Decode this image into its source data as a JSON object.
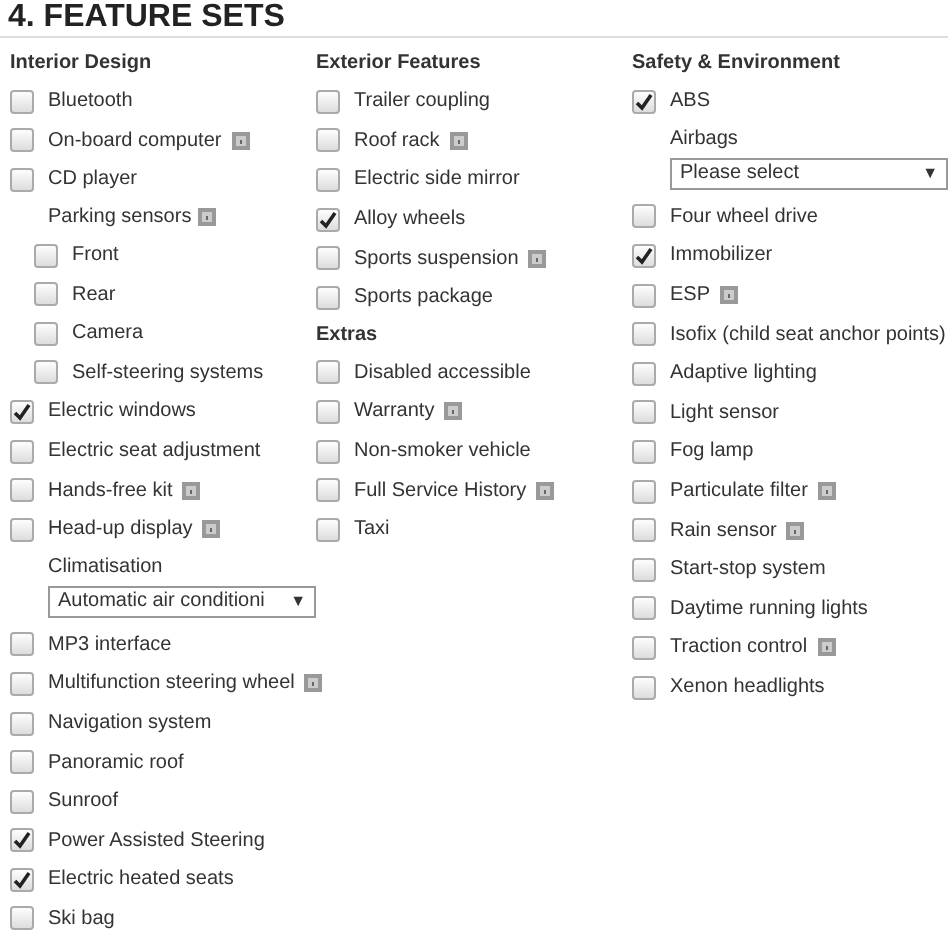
{
  "title": "4. FEATURE SETS",
  "columns": [
    {
      "sections": [
        {
          "heading": "Interior Design",
          "items": [
            {
              "kind": "checkbox",
              "label": "Bluetooth",
              "checked": false,
              "help": false
            },
            {
              "kind": "checkbox",
              "label": "On-board computer",
              "checked": false,
              "help": true
            },
            {
              "kind": "checkbox",
              "label": "CD player",
              "checked": false,
              "help": false
            },
            {
              "kind": "label",
              "label": "Parking sensors",
              "help": true,
              "children": [
                {
                  "kind": "checkbox",
                  "label": "Front",
                  "checked": false,
                  "help": false
                },
                {
                  "kind": "checkbox",
                  "label": "Rear",
                  "checked": false,
                  "help": false
                },
                {
                  "kind": "checkbox",
                  "label": "Camera",
                  "checked": false,
                  "help": false
                },
                {
                  "kind": "checkbox",
                  "label": "Self-steering systems",
                  "checked": false,
                  "help": false
                }
              ]
            },
            {
              "kind": "checkbox",
              "label": "Electric windows",
              "checked": true,
              "help": false
            },
            {
              "kind": "checkbox",
              "label": "Electric seat adjustment",
              "checked": false,
              "help": false
            },
            {
              "kind": "checkbox",
              "label": "Hands-free kit",
              "checked": false,
              "help": true
            },
            {
              "kind": "checkbox",
              "label": "Head-up display",
              "checked": false,
              "help": true
            },
            {
              "kind": "select",
              "label": "Climatisation",
              "value": "Automatic air conditioni",
              "arrow": "▼"
            },
            {
              "kind": "checkbox",
              "label": "MP3 interface",
              "checked": false,
              "help": false
            },
            {
              "kind": "checkbox",
              "label": "Multifunction steering wheel",
              "checked": false,
              "help": true
            },
            {
              "kind": "checkbox",
              "label": "Navigation system",
              "checked": false,
              "help": false
            },
            {
              "kind": "checkbox",
              "label": "Panoramic roof",
              "checked": false,
              "help": false
            },
            {
              "kind": "checkbox",
              "label": "Sunroof",
              "checked": false,
              "help": false
            },
            {
              "kind": "checkbox",
              "label": "Power Assisted Steering",
              "checked": true,
              "help": false
            },
            {
              "kind": "checkbox",
              "label": "Electric heated seats",
              "checked": true,
              "help": false
            },
            {
              "kind": "checkbox",
              "label": "Ski bag",
              "checked": false,
              "help": false
            }
          ]
        }
      ]
    },
    {
      "sections": [
        {
          "heading": "Exterior Features",
          "items": [
            {
              "kind": "checkbox",
              "label": "Trailer coupling",
              "checked": false,
              "help": false
            },
            {
              "kind": "checkbox",
              "label": "Roof rack",
              "checked": false,
              "help": true
            },
            {
              "kind": "checkbox",
              "label": "Electric side mirror",
              "checked": false,
              "help": false
            },
            {
              "kind": "checkbox",
              "label": "Alloy wheels",
              "checked": true,
              "help": false
            },
            {
              "kind": "checkbox",
              "label": "Sports suspension",
              "checked": false,
              "help": true
            },
            {
              "kind": "checkbox",
              "label": "Sports package",
              "checked": false,
              "help": false
            }
          ]
        },
        {
          "heading": "Extras",
          "items": [
            {
              "kind": "checkbox",
              "label": "Disabled accessible",
              "checked": false,
              "help": false
            },
            {
              "kind": "checkbox",
              "label": "Warranty",
              "checked": false,
              "help": true
            },
            {
              "kind": "checkbox",
              "label": "Non-smoker vehicle",
              "checked": false,
              "help": false
            },
            {
              "kind": "checkbox",
              "label": "Full Service History",
              "checked": false,
              "help": true
            },
            {
              "kind": "checkbox",
              "label": "Taxi",
              "checked": false,
              "help": false
            }
          ]
        }
      ]
    },
    {
      "sections": [
        {
          "heading": "Safety & Environment",
          "items": [
            {
              "kind": "checkbox",
              "label": "ABS",
              "checked": true,
              "help": false
            },
            {
              "kind": "select",
              "label": "Airbags",
              "value": "Please select",
              "arrow": "▼"
            },
            {
              "kind": "checkbox",
              "label": "Four wheel drive",
              "checked": false,
              "help": false
            },
            {
              "kind": "checkbox",
              "label": "Immobilizer",
              "checked": true,
              "help": false
            },
            {
              "kind": "checkbox",
              "label": "ESP",
              "checked": false,
              "help": true
            },
            {
              "kind": "checkbox",
              "label": "Isofix (child seat anchor points)",
              "checked": false,
              "help": false
            },
            {
              "kind": "checkbox",
              "label": "Adaptive lighting",
              "checked": false,
              "help": false
            },
            {
              "kind": "checkbox",
              "label": "Light sensor",
              "checked": false,
              "help": false
            },
            {
              "kind": "checkbox",
              "label": "Fog lamp",
              "checked": false,
              "help": false
            },
            {
              "kind": "checkbox",
              "label": "Particulate filter",
              "checked": false,
              "help": true
            },
            {
              "kind": "checkbox",
              "label": "Rain sensor",
              "checked": false,
              "help": true
            },
            {
              "kind": "checkbox",
              "label": "Start-stop system",
              "checked": false,
              "help": false
            },
            {
              "kind": "checkbox",
              "label": "Daytime running lights",
              "checked": false,
              "help": false
            },
            {
              "kind": "checkbox",
              "label": "Traction control",
              "checked": false,
              "help": true
            },
            {
              "kind": "checkbox",
              "label": "Xenon headlights",
              "checked": false,
              "help": false
            }
          ]
        }
      ]
    }
  ]
}
